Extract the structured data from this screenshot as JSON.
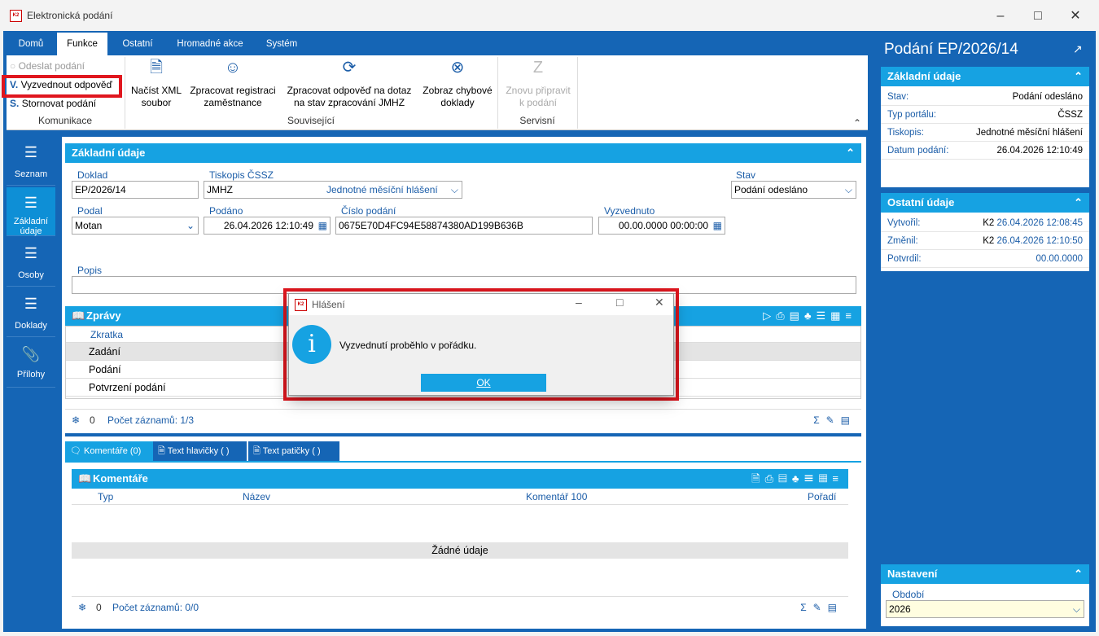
{
  "window": {
    "title": "Elektronická podání"
  },
  "ribbon": {
    "tabs": [
      "Domů",
      "Funkce",
      "Ostatní",
      "Hromadné akce",
      "Systém"
    ],
    "communication": {
      "items": [
        "Odeslat podání",
        "Vyzvednout odpověď",
        "Stornovat podání"
      ],
      "label": "Komunikace"
    },
    "related": {
      "buttons": [
        {
          "label1": "Načíst XML",
          "label2": "soubor"
        },
        {
          "label1": "Zpracovat registraci",
          "label2": "zaměstnance"
        },
        {
          "label1": "Zpracovat odpověď na dotaz",
          "label2": "na stav zpracování JMHZ"
        },
        {
          "label1": "Zobraz chybové",
          "label2": "doklady"
        }
      ],
      "label": "Související"
    },
    "service": {
      "button": {
        "label1": "Znovu připravit",
        "label2": "k podání"
      },
      "label": "Servisní"
    }
  },
  "leftnav": [
    "Seznam",
    "Základní údaje",
    "Osoby",
    "Doklady",
    "Přílohy"
  ],
  "basic": {
    "title": "Základní údaje",
    "doklad_label": "Doklad",
    "doklad_value": "EP/2026/14",
    "tiskopis_label": "Tiskopis ČSSZ",
    "tiskopis_code": "JMHZ",
    "tiskopis_name": "Jednotné měsíční hlášení",
    "stav_label": "Stav",
    "stav_value": "Podání odesláno",
    "podal_label": "Podal",
    "podal_value": "Motan",
    "podano_label": "Podáno",
    "podano_value": "26.04.2026 12:10:49",
    "cislo_label": "Číslo podání",
    "cislo_value": "0675E70D4FC94E58874380AD199B636B",
    "vyzvednuto_label": "Vyzvednuto",
    "vyzvednuto_value": "00.00.0000 00:00:00",
    "popis_label": "Popis"
  },
  "zpravy": {
    "title": "Zprávy",
    "column": "Zkratka",
    "rows": [
      "Zadání",
      "Podání",
      "Potvrzení podání"
    ],
    "count_zero": "0",
    "count_text": "Počet záznamů: 1/3"
  },
  "bottom_tabs": [
    "Komentáře (0)",
    "Text hlavičky ( )",
    "Text patičky ( )"
  ],
  "komentare": {
    "title": "Komentáře",
    "columns": [
      "Typ",
      "Název",
      "Komentář 100",
      "Pořadí"
    ],
    "empty": "Žádné údaje",
    "count_zero": "0",
    "count_text": "Počet záznamů: 0/0"
  },
  "right": {
    "title": "Podání EP/2026/14",
    "basic_title": "Základní údaje",
    "basic_rows": [
      {
        "k": "Stav:",
        "v": "Podání odesláno"
      },
      {
        "k": "Typ portálu:",
        "v": "ČSSZ"
      },
      {
        "k": "Tiskopis:",
        "v": "Jednotné měsíční hlášení"
      },
      {
        "k": "Datum podání:",
        "v": "26.04.2026 12:10:49"
      }
    ],
    "other_title": "Ostatní údaje",
    "other_rows": [
      {
        "k": "Vytvořil:",
        "u": "K2",
        "v": "26.04.2026 12:08:45"
      },
      {
        "k": "Změnil:",
        "u": "K2",
        "v": "26.04.2026 12:10:50"
      },
      {
        "k": "Potvrdil:",
        "u": "",
        "v": "00.00.0000"
      }
    ],
    "settings_title": "Nastavení",
    "obdobi_label": "Období",
    "obdobi_value": "2026"
  },
  "dialog": {
    "title": "Hlášení",
    "message": "Vyzvednutí proběhlo v pořádku.",
    "ok": "OK"
  },
  "colors": {
    "primary": "#1565b5",
    "accent": "#16a2e2",
    "highlight": "#e0161e"
  }
}
